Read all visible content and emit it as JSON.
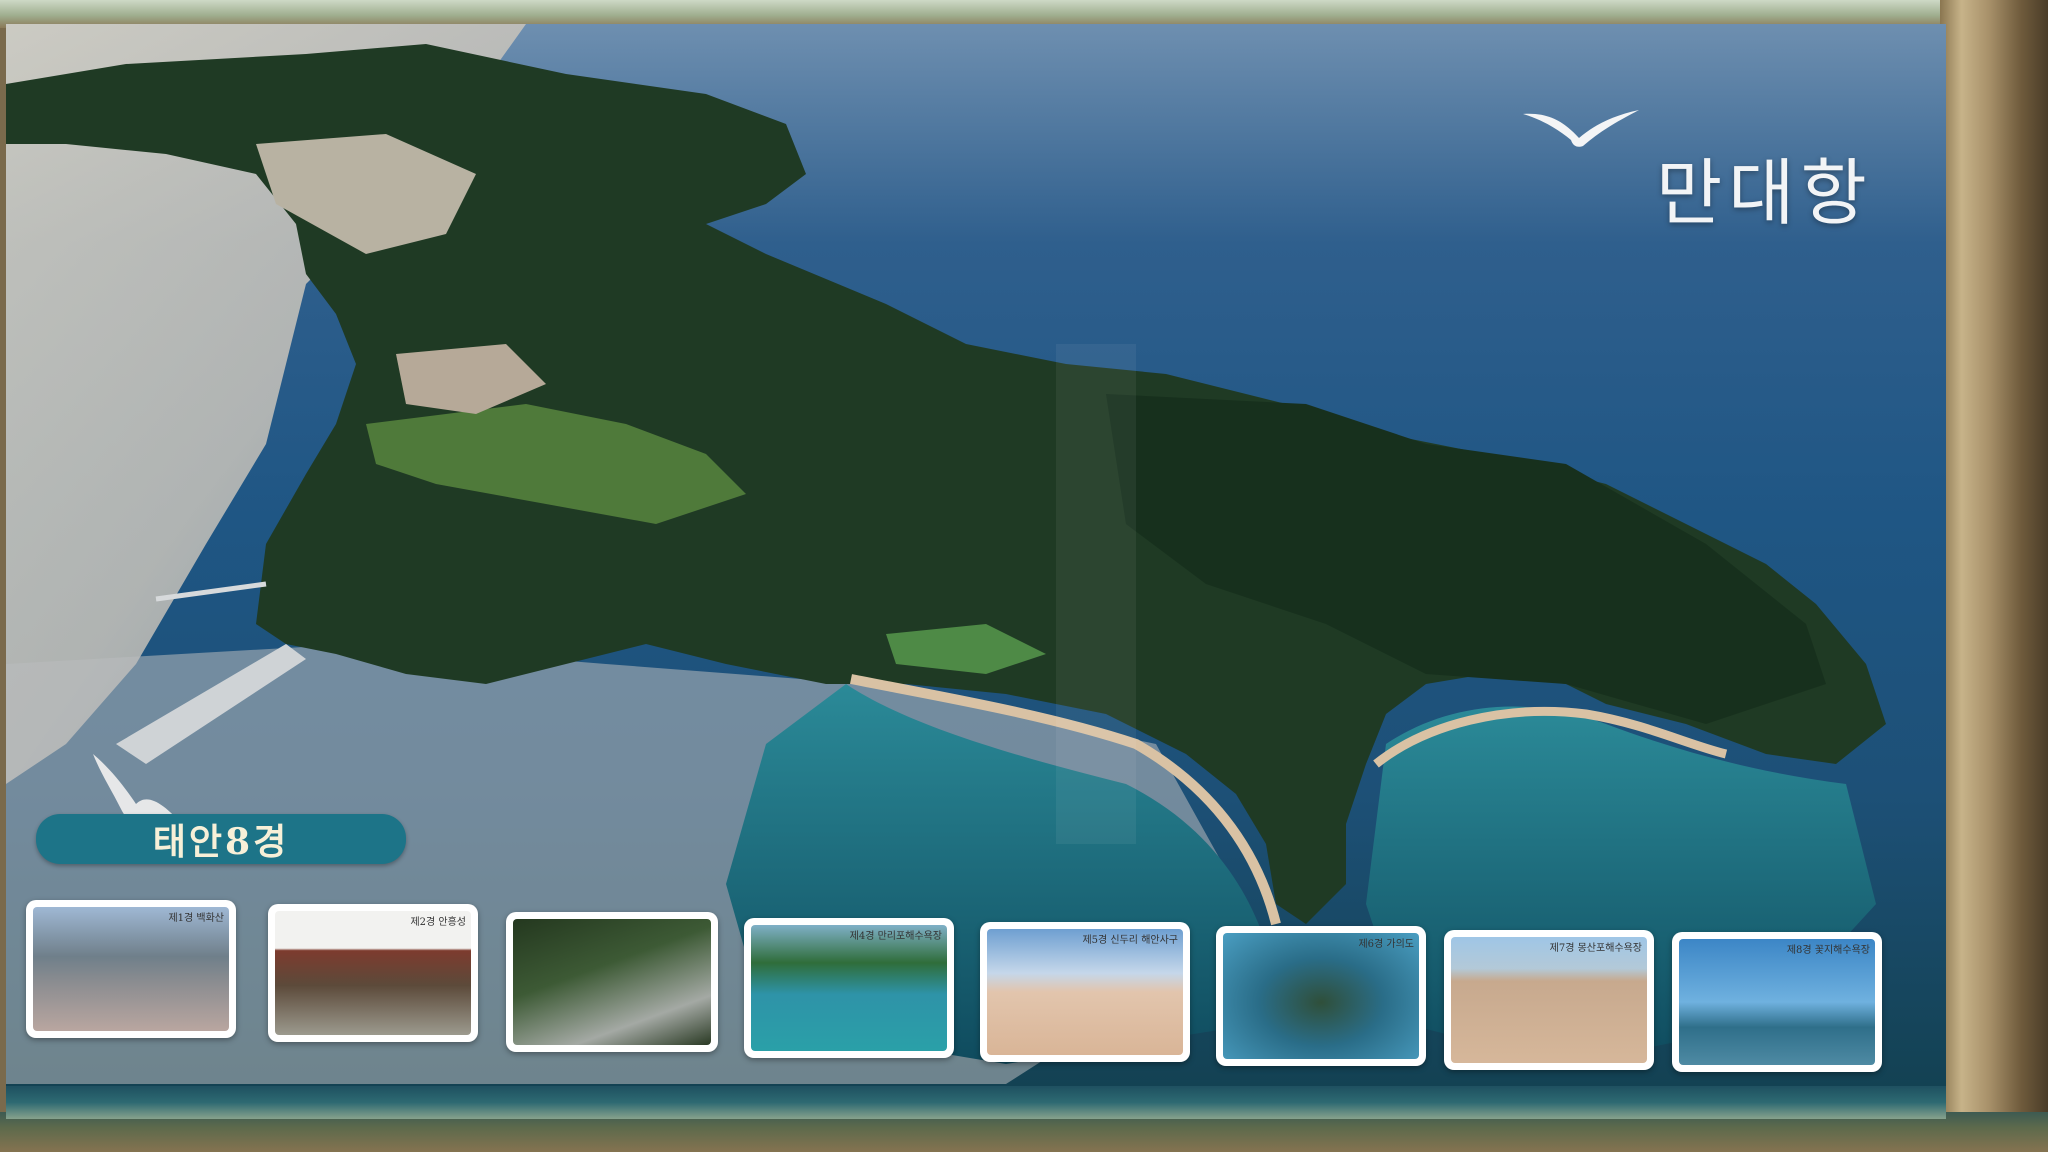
{
  "poster": {
    "title": "만대항",
    "badge": "태안8경",
    "thumbnails": [
      {
        "caption": "제1경 백화산"
      },
      {
        "caption": "제2경 안흥성"
      },
      {
        "caption": ""
      },
      {
        "caption": "제4경 만리포해수욕장"
      },
      {
        "caption": "제5경 신두리 해안사구"
      },
      {
        "caption": "제6경 가의도"
      },
      {
        "caption": "제7경 몽산포해수욕장"
      },
      {
        "caption": "제8경 꽃지해수욕장"
      }
    ]
  },
  "colors": {
    "sea": "#1f5684",
    "land": "#1f3a24",
    "badge": "#1d7488"
  },
  "icons": [
    "seagull-icon",
    "seagull-icon"
  ]
}
